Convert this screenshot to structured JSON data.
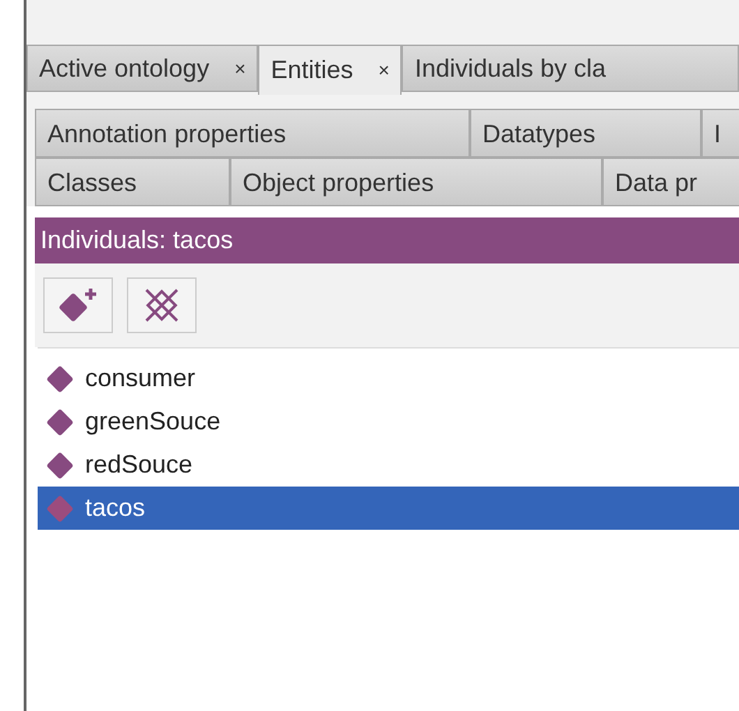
{
  "tabs": [
    {
      "label": "Active ontology",
      "close": "×",
      "selected": false
    },
    {
      "label": "Entities",
      "close": "×",
      "selected": true
    },
    {
      "label": "Individuals by cla",
      "selected": false
    }
  ],
  "entity_tabs": [
    [
      {
        "label": "Annotation properties"
      },
      {
        "label": "Datatypes"
      },
      {
        "label": "I"
      }
    ],
    [
      {
        "label": "Classes"
      },
      {
        "label": "Object properties"
      },
      {
        "label": "Data pr"
      }
    ]
  ],
  "panel": {
    "title": "Individuals: tacos"
  },
  "individuals": [
    {
      "name": "consumer",
      "selected": false
    },
    {
      "name": "greenSouce",
      "selected": false
    },
    {
      "name": "redSouce",
      "selected": false
    },
    {
      "name": "tacos",
      "selected": true
    }
  ]
}
